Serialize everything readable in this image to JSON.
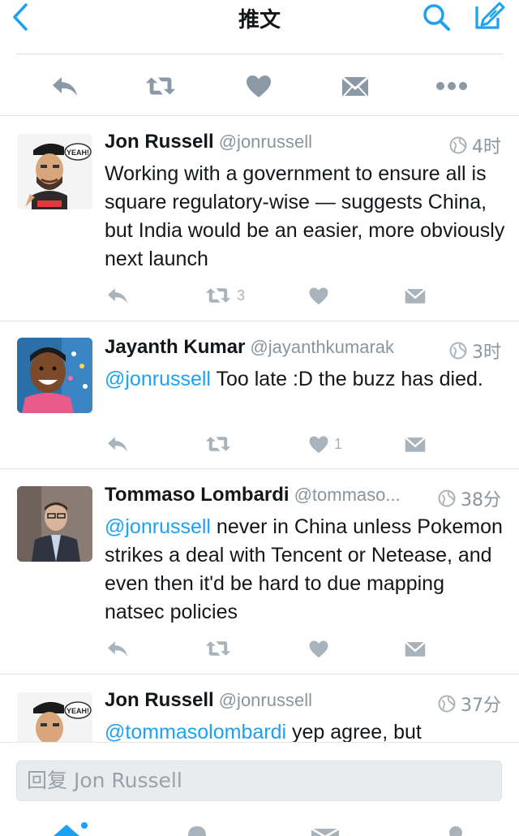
{
  "nav": {
    "title": "推文",
    "back_icon": "chevron-left-icon",
    "search_icon": "search-icon",
    "compose_icon": "compose-icon",
    "accent": "#1da1f2"
  },
  "main_actions": [
    "reply-icon",
    "retweet-icon",
    "like-icon",
    "message-icon",
    "more-icon"
  ],
  "tweets": [
    {
      "name": "Jon Russell",
      "handle": "@jonrussell",
      "time": "4时",
      "text": "Working with a government to ensure all is square regulatory-wise — suggests China, but India would be an easier, more obviously next launch",
      "mention": "",
      "retweets": "3",
      "likes": ""
    },
    {
      "name": "Jayanth Kumar",
      "handle": "@jayanthkumarak",
      "time": "3时",
      "mention": "@jonrussell",
      "text": " Too late :D the buzz has died.",
      "retweets": "",
      "likes": "1"
    },
    {
      "name": "Tommaso Lombardi",
      "handle": "@tommaso...",
      "time": "38分",
      "mention": "@jonrussell",
      "text": " never in China unless Pokemon strikes a deal with Tencent or Netease, and even then it'd be hard to due mapping natsec policies",
      "retweets": "",
      "likes": ""
    },
    {
      "name": "Jon Russell",
      "handle": "@jonrussell",
      "time": "37分",
      "mention": "@tommasolombardi",
      "text": " yep agree, but",
      "retweets": "",
      "likes": ""
    }
  ],
  "reply": {
    "placeholder": "回复 Jon Russell"
  },
  "colors": {
    "icon_gray": "#8b98a5",
    "action_gray": "#a8b3bb",
    "blue": "#1da1f2"
  }
}
